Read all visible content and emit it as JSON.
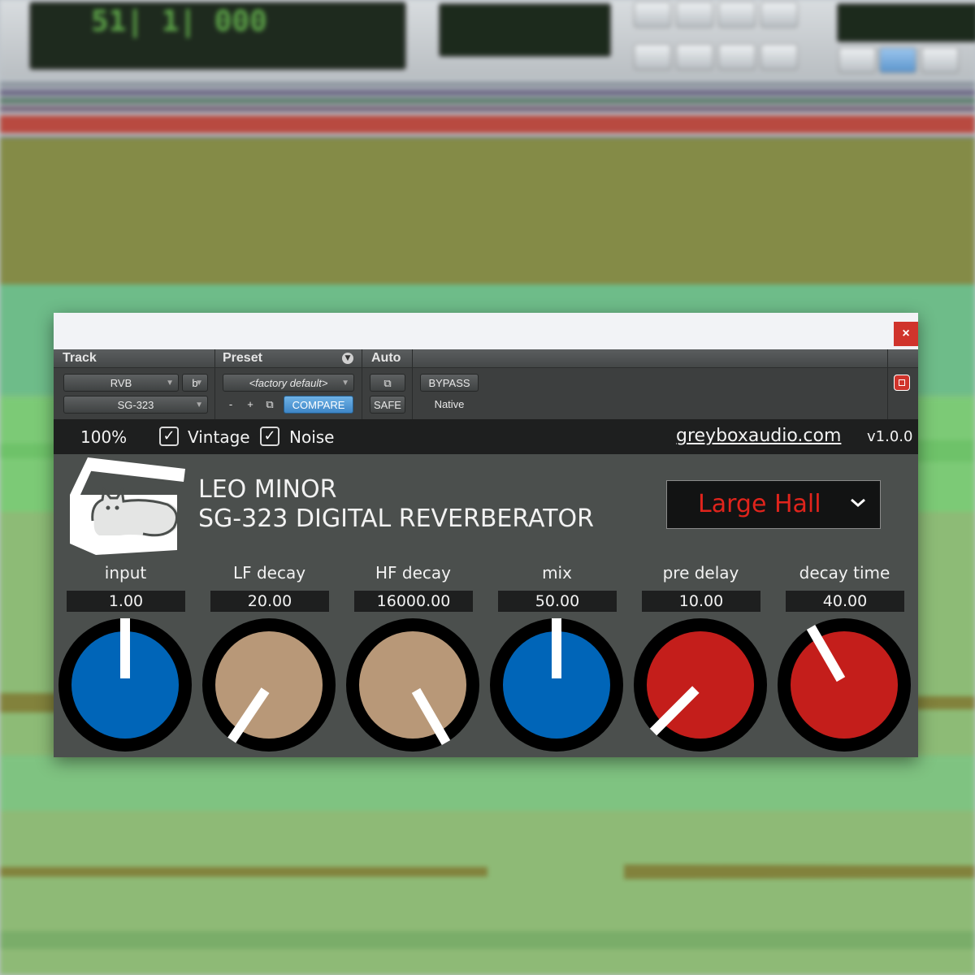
{
  "background": {
    "toolbar_counter": "51| 1| 000"
  },
  "plugin": {
    "close_label": "×",
    "header": {
      "track_label": "Track",
      "preset_label": "Preset",
      "auto_label": "Auto",
      "track_name": "RVB",
      "track_channel": "b",
      "insert_name": "SG-323",
      "preset_name": "<factory default>",
      "minus_label": "-",
      "plus_label": "+",
      "compare_label": "COMPARE",
      "bypass_label": "BYPASS",
      "native_label": "Native",
      "safe_label": "SAFE"
    },
    "options": {
      "scale": "100%",
      "vintage_label": "Vintage",
      "vintage_checked": true,
      "noise_label": "Noise",
      "noise_checked": true,
      "url": "greyboxaudio.com",
      "version": "v1.0.0"
    },
    "title_line1": "LEO MINOR",
    "title_line2": "SG-323 DIGITAL REVERBERATOR",
    "algorithm": "Large Hall",
    "params": [
      {
        "label": "input",
        "value": "1.00",
        "color": "#0065b8",
        "angle": 0
      },
      {
        "label": "LF decay",
        "value": "20.00",
        "color": "#b89878",
        "angle": -146
      },
      {
        "label": "HF decay",
        "value": "16000.00",
        "color": "#b89878",
        "angle": 150
      },
      {
        "label": "mix",
        "value": "50.00",
        "color": "#0065b8",
        "angle": 0
      },
      {
        "label": "pre delay",
        "value": "10.00",
        "color": "#c41e1b",
        "angle": -135
      },
      {
        "label": "decay time",
        "value": "40.00",
        "color": "#c41e1b",
        "angle": -30
      }
    ]
  }
}
